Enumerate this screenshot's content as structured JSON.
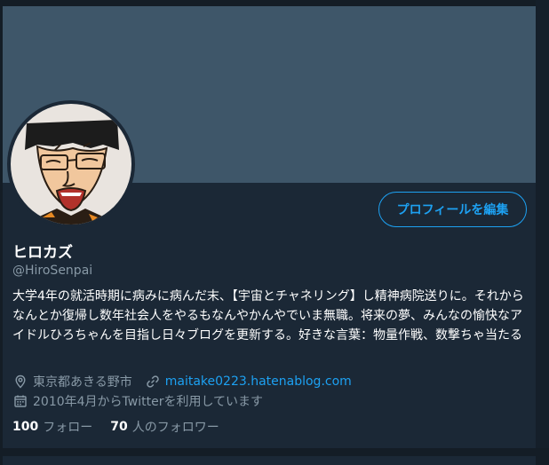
{
  "profile": {
    "name": "ヒロカズ",
    "handle": "@HiroSenpai",
    "bio": "大学4年の就活時期に病みに病んだ末、【宇宙とチャネリング】し精神病院送りに。それからなんとか復帰し数年社会人をやるもなんやかんやでいま無職。将来の夢、みんなの愉快なアイドルひろちゃんを目指し日々ブログを更新する。好きな言葉：物量作戦、数撃ちゃ当たる",
    "location": "東京都あきる野市",
    "website": "maitake0223.hatenablog.com",
    "joined": "2010年4月からTwitterを利用しています"
  },
  "actions": {
    "edit_profile_label": "プロフィールを編集"
  },
  "stats": {
    "following_count": "100",
    "following_label": "フォロー",
    "followers_count": "70",
    "followers_label": "人のフォロワー"
  },
  "icons": {
    "location": "location-pin-icon",
    "website": "link-icon",
    "joined": "calendar-icon"
  },
  "colors": {
    "accent": "#1da1f2",
    "background": "#1b2836",
    "banner": "#3e5669",
    "secondary_text": "#8899a6"
  }
}
